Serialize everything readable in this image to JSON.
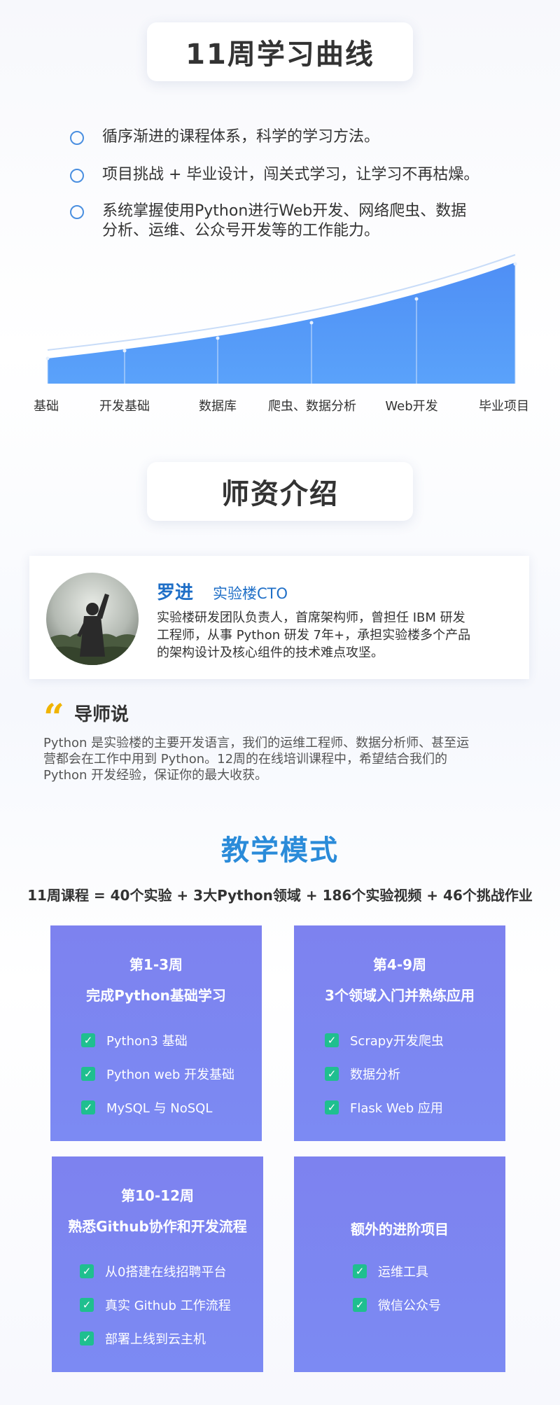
{
  "curve_section": {
    "title": "11周学习曲线",
    "bullets": [
      "循序渐进的课程体系，科学的学习方法。",
      "项目挑战 + 毕业设计，闯关式学习，让学习不再枯燥。",
      "系统掌握使用Python进行Web开发、网络爬虫、数据",
      "分析、运维、公众号开发等的工作能力。"
    ],
    "stage_labels": [
      "基础",
      "开发基础",
      "数据库",
      "爬虫、数据分析",
      "Web开发",
      "毕业项目"
    ],
    "colors": {
      "area": "#4f97f7",
      "line": "#c8dcf8",
      "bullet": "#4a8fe0"
    }
  },
  "teacher_section": {
    "title": "师资介绍",
    "name": "罗进",
    "role": "实验楼CTO",
    "desc_lines": [
      "实验楼研发团队负责人，首席架构师，曾担任 IBM 研发",
      "工程师，从事 Python 研发 7年+，承担实验楼多个产品",
      "的架构设计及核心组件的技术难点攻坚。"
    ],
    "quote_mark": "“",
    "quote_title": "导师说",
    "quote_lines": [
      "Python 是实验楼的主要开发语言，我们的运维工程师、数据分析师、甚至运",
      "营都会在工作中用到 Python。12周的在线培训课程中，希望结合我们的",
      "Python 开发经验，保证你的最大收获。"
    ]
  },
  "mode_section": {
    "title": "教学模式",
    "formula": "11周课程 = 40个实验 + 3大Python领域 + 186个实验视频 + 46个挑战作业",
    "check_glyph": "✓",
    "blocks": [
      {
        "week": "第1-3周",
        "subject": "完成Python基础学习",
        "items": [
          "Python3 基础",
          "Python web 开发基础",
          "MySQL 与 NoSQL"
        ]
      },
      {
        "week": "第4-9周",
        "subject": "3个领域入门并熟练应用",
        "items": [
          "Scrapy开发爬虫",
          "数据分析",
          "Flask Web 应用"
        ]
      },
      {
        "week": "第10-12周",
        "subject": "熟悉Github协作和开发流程",
        "items": [
          "从0搭建在线招聘平台",
          "真实 Github 工作流程",
          "部署上线到云主机"
        ]
      },
      {
        "week": "",
        "subject": "额外的进阶项目",
        "items": [
          "运维工具",
          "微信公众号"
        ]
      }
    ],
    "colors": {
      "block": "#7d84f0",
      "check": "#1fbf8f",
      "title": "#2a8bd9"
    }
  }
}
